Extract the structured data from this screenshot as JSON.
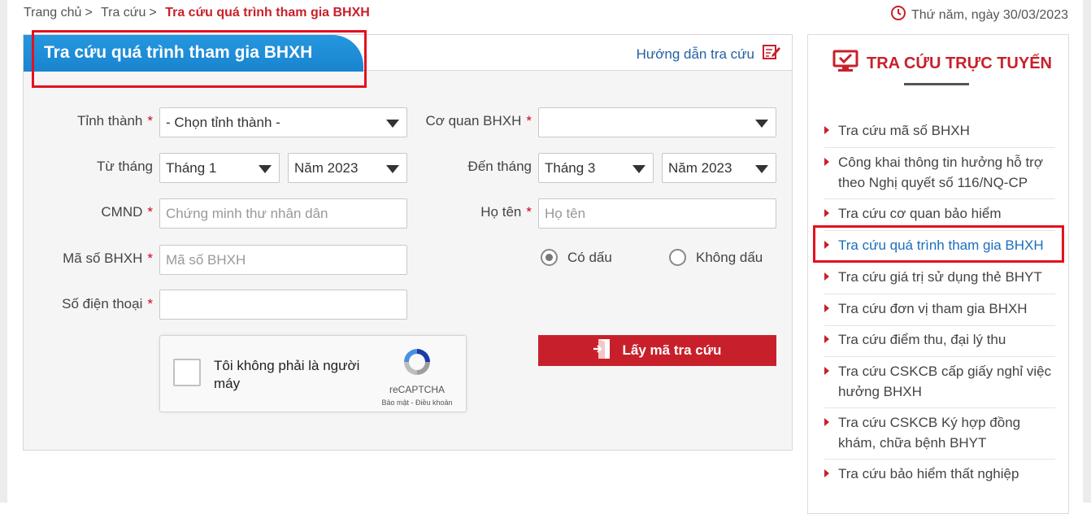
{
  "breadcrumb": {
    "home": "Trang chủ",
    "sep": ">",
    "section": "Tra cứu",
    "current": "Tra cứu quá trình tham gia BHXH"
  },
  "date_text": "Thứ năm, ngày 30/03/2023",
  "panel": {
    "title": "Tra cứu quá trình tham gia BHXH",
    "help_link": "Hướng dẫn tra cứu"
  },
  "form": {
    "required_mark": "*",
    "province": {
      "label": "Tỉnh thành",
      "value": "- Chọn tỉnh thành -"
    },
    "agency": {
      "label": "Cơ quan BHXH",
      "value": ""
    },
    "from": {
      "label": "Từ tháng",
      "month": "Tháng 1",
      "year": "Năm 2023"
    },
    "to": {
      "label": "Đến tháng",
      "month": "Tháng 3",
      "year": "Năm 2023"
    },
    "id_card": {
      "label": "CMND",
      "placeholder": "Chứng minh thư nhân dân"
    },
    "name": {
      "label": "Họ tên",
      "placeholder": "Họ tên"
    },
    "insurance_no": {
      "label": "Mã số BHXH",
      "placeholder": "Mã số BHXH"
    },
    "phone": {
      "label": "Số điện thoại",
      "placeholder": ""
    },
    "accent_options": [
      {
        "label": "Có dấu",
        "selected": true
      },
      {
        "label": "Không dấu",
        "selected": false
      }
    ],
    "captcha": {
      "text": "Tôi không phải là người máy",
      "brand": "reCAPTCHA",
      "links": "Bảo mật - Điều khoản"
    },
    "submit_label": "Lấy mã tra cứu"
  },
  "sidebar": {
    "title": "TRA CỨU TRỰC TUYẾN",
    "items": [
      {
        "label": "Tra cứu mã số BHXH"
      },
      {
        "label": "Công khai thông tin hưởng hỗ trợ theo Nghị quyết số 116/NQ-CP"
      },
      {
        "label": "Tra cứu cơ quan bảo hiểm"
      },
      {
        "label": "Tra cứu quá trình tham gia BHXH",
        "active": true
      },
      {
        "label": "Tra cứu giá trị sử dụng thẻ BHYT"
      },
      {
        "label": "Tra cứu đơn vị tham gia BHXH"
      },
      {
        "label": "Tra cứu điểm thu, đại lý thu"
      },
      {
        "label": "Tra cứu CSKCB cấp giấy nghỉ việc hưởng BHXH"
      },
      {
        "label": "Tra cứu CSKCB Ký hợp đồng khám, chữa bệnh BHYT"
      },
      {
        "label": "Tra cứu bảo hiểm thất nghiệp"
      }
    ]
  },
  "colors": {
    "brand_red": "#c8202b",
    "tab_blue": "#1e8fdc",
    "link_blue": "#1b6dbf",
    "highlight": "#e3121d"
  }
}
